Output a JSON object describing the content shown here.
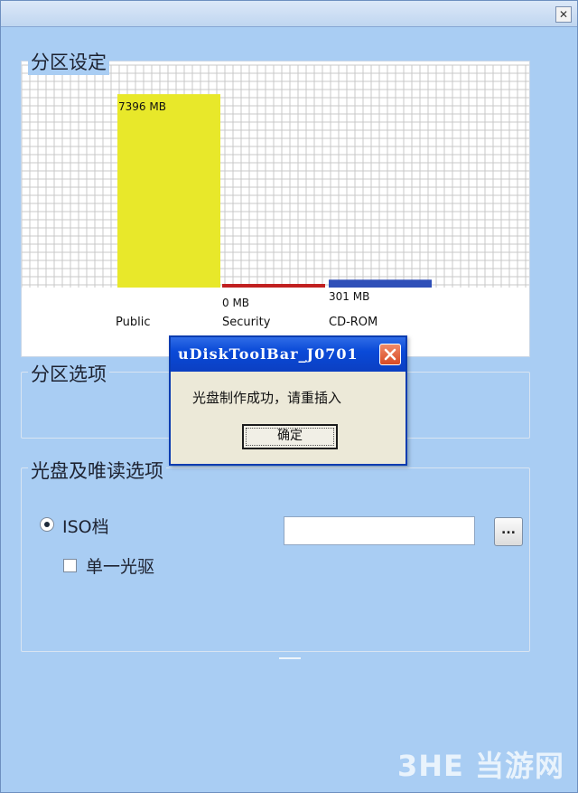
{
  "window": {
    "close_icon": "close-icon"
  },
  "partition_settings": {
    "label": "分区设定"
  },
  "chart_data": {
    "type": "bar",
    "categories": [
      "Public",
      "Security",
      "CD-ROM"
    ],
    "values": [
      7396,
      0,
      301
    ],
    "value_labels": [
      "7396 MB",
      "0 MB",
      "301 MB"
    ],
    "colors": [
      "#e8e82a",
      "#c02020",
      "#2f4fb8"
    ],
    "ylim": [
      0,
      7400
    ],
    "grid": true
  },
  "partition_options": {
    "label": "分区选项"
  },
  "disc_options": {
    "label": "光盘及唯读选项",
    "iso_label": "ISO档",
    "iso_selected": true,
    "single_drive_label": "单一光驱",
    "single_drive_checked": false,
    "path_value": "",
    "browse_label": "..."
  },
  "dialog": {
    "title": "uDiskToolBar_J0701",
    "message": "光盘制作成功，请重插入",
    "ok_label": "确定"
  },
  "watermark": {
    "text": "3HE 当游网"
  }
}
